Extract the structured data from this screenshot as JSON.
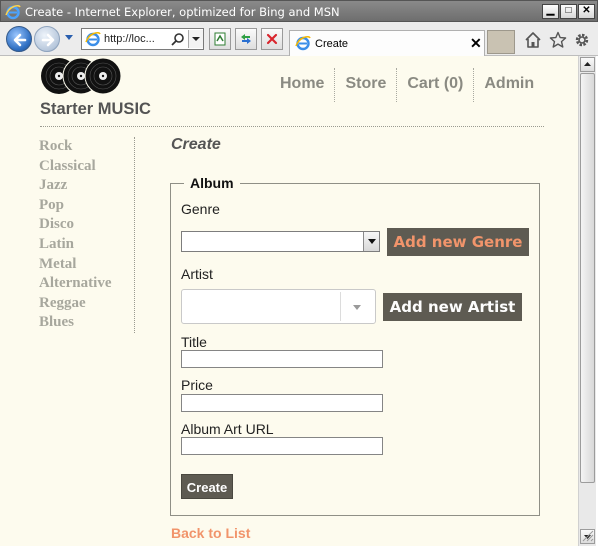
{
  "window": {
    "title": "Create - Internet Explorer, optimized for Bing and MSN",
    "min_glyph": "▁",
    "max_glyph": "□",
    "close_glyph": "✕"
  },
  "browser": {
    "url": "http://loc...",
    "tab_title": "Create",
    "tab_close": "✕",
    "icons": [
      "back-icon",
      "forward-icon",
      "ie-icon",
      "search-icon",
      "compat-view-icon",
      "refresh-icon",
      "stop-icon",
      "home-icon",
      "favorites-star-icon",
      "gear-icon"
    ]
  },
  "site": {
    "title": "Starter MUSIC",
    "nav": [
      "Home",
      "Store",
      "Cart (0)",
      "Admin"
    ],
    "genres": [
      "Rock",
      "Classical",
      "Jazz",
      "Pop",
      "Disco",
      "Latin",
      "Metal",
      "Alternative",
      "Reggae",
      "Blues"
    ]
  },
  "form": {
    "heading": "Create",
    "legend": "Album",
    "genre_label": "Genre",
    "add_genre_label": "Add new Genre",
    "artist_label": "Artist",
    "add_artist_label": "Add new Artist",
    "title_label": "Title",
    "price_label": "Price",
    "url_label": "Album Art URL",
    "title_value": "",
    "price_value": "",
    "url_value": "",
    "submit_label": "Create",
    "back_link": "Back to List"
  },
  "colors": {
    "page_bg": "#fdfbee",
    "button_bg": "#5e5b52",
    "accent_orange": "#f1946b",
    "muted_text": "#a7a79d"
  }
}
